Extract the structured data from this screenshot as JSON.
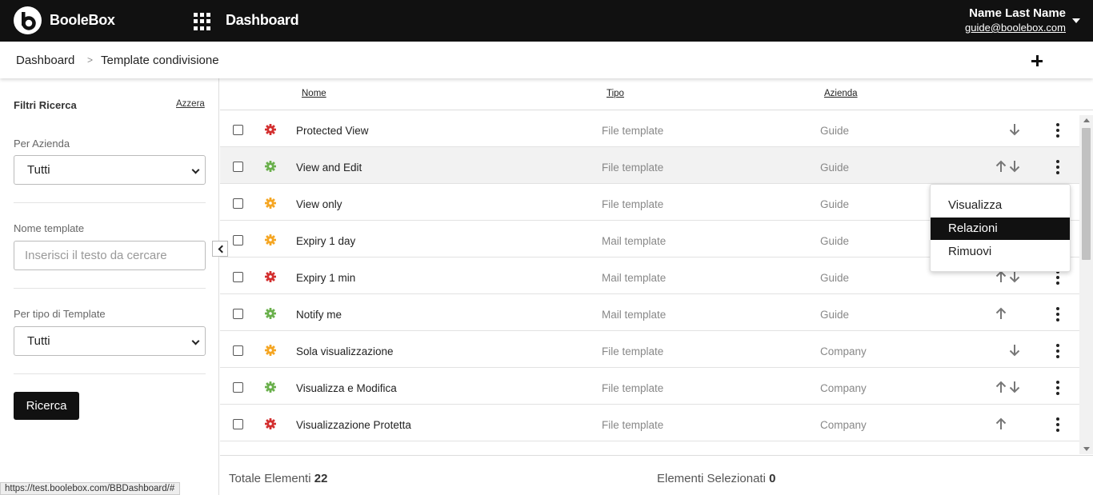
{
  "app": {
    "brand": "BooleBox",
    "title": "Dashboard"
  },
  "user": {
    "name": "Name Last Name",
    "email": "guide@boolebox.com"
  },
  "breadcrumb": {
    "home": "Dashboard",
    "separator": ">",
    "current": "Template condivisione"
  },
  "filters": {
    "title": "Filtri Ricerca",
    "reset": "Azzera",
    "company_label": "Per Azienda",
    "company_value": "Tutti",
    "name_label": "Nome template",
    "name_placeholder": "Inserisci il testo da cercare",
    "type_label": "Per tipo di Template",
    "type_value": "Tutti",
    "search_button": "Ricerca"
  },
  "table": {
    "headers": {
      "name": "Nome",
      "type": "Tipo",
      "company": "Azienda"
    },
    "rows": [
      {
        "name": "Protected View",
        "type": "File template",
        "company": "Guide",
        "status_color": "#d32f2f",
        "arrows": "down"
      },
      {
        "name": "View and Edit",
        "type": "File template",
        "company": "Guide",
        "status_color": "#6ab04c",
        "arrows": "both"
      },
      {
        "name": "View only",
        "type": "File template",
        "company": "Guide",
        "status_color": "#f5a623",
        "arrows": "both"
      },
      {
        "name": "Expiry 1 day",
        "type": "Mail template",
        "company": "Guide",
        "status_color": "#f5a623",
        "arrows": "both"
      },
      {
        "name": "Expiry 1 min",
        "type": "Mail template",
        "company": "Guide",
        "status_color": "#d32f2f",
        "arrows": "both"
      },
      {
        "name": "Notify me",
        "type": "Mail template",
        "company": "Guide",
        "status_color": "#6ab04c",
        "arrows": "up"
      },
      {
        "name": "Sola visualizzazione",
        "type": "File template",
        "company": "Company",
        "status_color": "#f5a623",
        "arrows": "down"
      },
      {
        "name": "Visualizza e Modifica",
        "type": "File template",
        "company": "Company",
        "status_color": "#6ab04c",
        "arrows": "both"
      },
      {
        "name": "Visualizzazione Protetta",
        "type": "File template",
        "company": "Company",
        "status_color": "#d32f2f",
        "arrows": "up"
      }
    ]
  },
  "footer": {
    "total_label": "Totale Elementi",
    "total_value": "22",
    "selected_label": "Elementi Selezionati",
    "selected_value": "0"
  },
  "context_menu": {
    "items": [
      "Visualizza",
      "Relazioni",
      "Rimuovi"
    ],
    "active": "Relazioni"
  },
  "status_url": "https://test.boolebox.com/BBDashboard/#",
  "icons": [
    "apps-grid-icon",
    "caret-down-icon",
    "plus-icon",
    "checkbox-checked-icon",
    "chevron-left-icon",
    "gear-icon",
    "arrow-up-icon",
    "arrow-down-icon",
    "more-vertical-icon"
  ]
}
